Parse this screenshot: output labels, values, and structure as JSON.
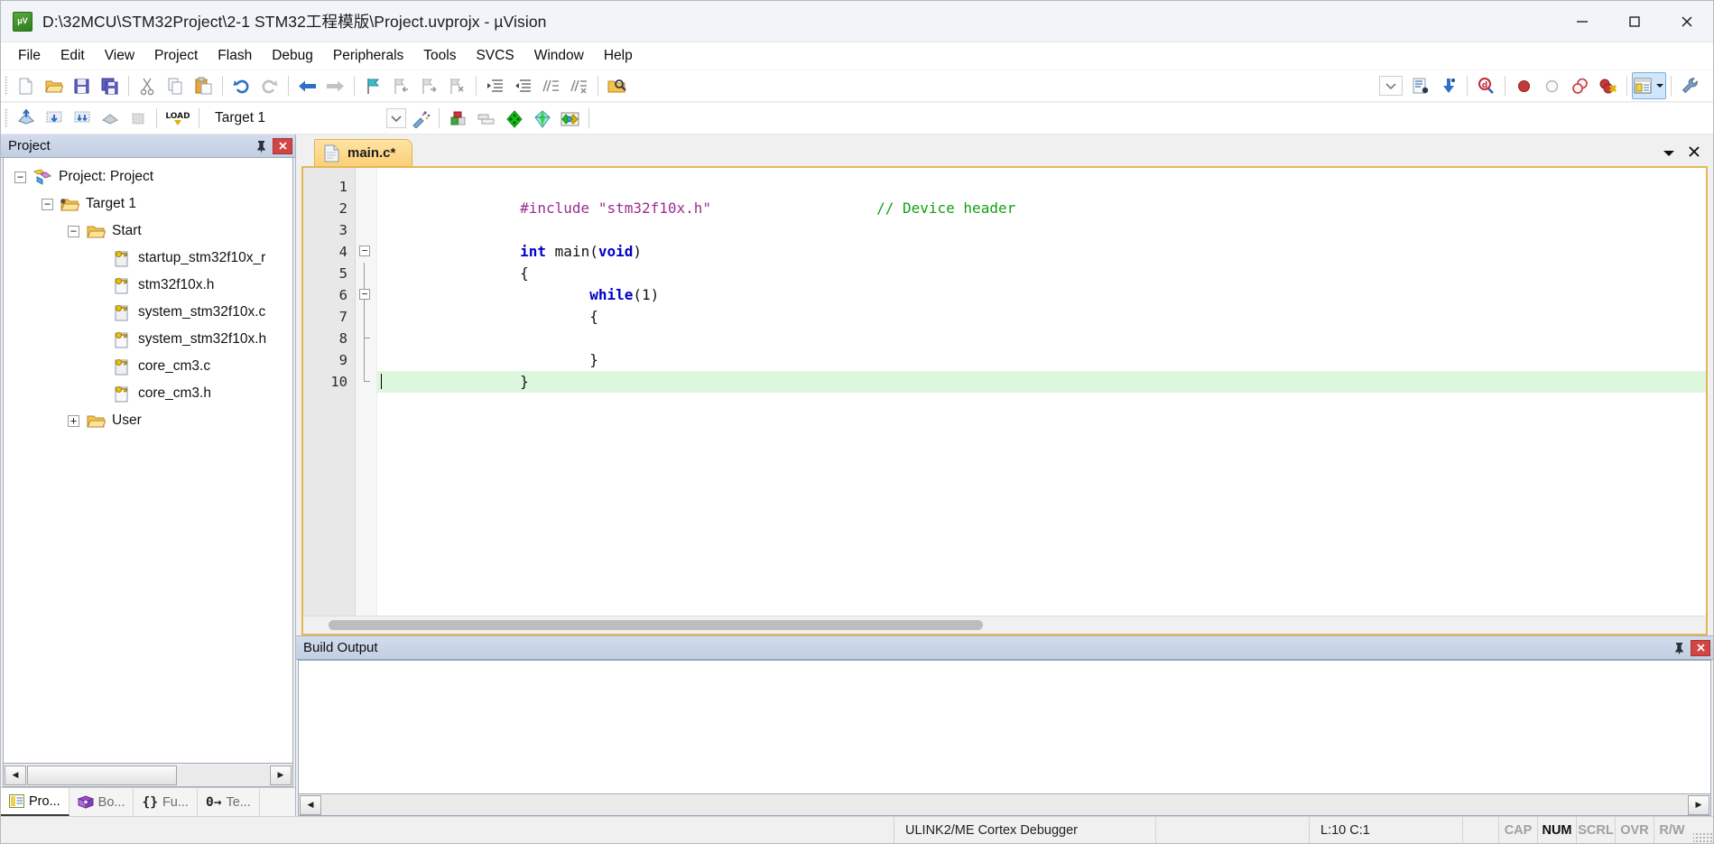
{
  "window": {
    "title": "D:\\32MCU\\STM32Project\\2-1 STM32工程模版\\Project.uvprojx - µVision",
    "app_icon": "uvision-icon",
    "minimize": "—",
    "maximize": "☐",
    "close": "✕"
  },
  "menu": {
    "items": [
      {
        "label": "File"
      },
      {
        "label": "Edit"
      },
      {
        "label": "View"
      },
      {
        "label": "Project"
      },
      {
        "label": "Flash"
      },
      {
        "label": "Debug"
      },
      {
        "label": "Peripherals"
      },
      {
        "label": "Tools"
      },
      {
        "label": "SVCS"
      },
      {
        "label": "Window"
      },
      {
        "label": "Help"
      }
    ]
  },
  "file_toolbar": {
    "buttons": [
      {
        "name": "new-file-icon",
        "title": "New"
      },
      {
        "name": "open-file-icon",
        "title": "Open"
      },
      {
        "name": "save-icon",
        "title": "Save"
      },
      {
        "name": "save-all-icon",
        "title": "Save All"
      },
      {
        "name": "cut-icon",
        "title": "Cut"
      },
      {
        "name": "copy-icon",
        "title": "Copy"
      },
      {
        "name": "paste-icon",
        "title": "Paste"
      },
      {
        "name": "undo-icon",
        "title": "Undo"
      },
      {
        "name": "redo-icon",
        "title": "Redo"
      },
      {
        "name": "navigate-back-icon",
        "title": "Back"
      },
      {
        "name": "navigate-forward-icon",
        "title": "Forward"
      },
      {
        "name": "bookmark-toggle-icon",
        "title": "Insert/Remove Bookmark"
      },
      {
        "name": "bookmark-prev-icon",
        "title": "Previous Bookmark"
      },
      {
        "name": "bookmark-next-icon",
        "title": "Next Bookmark"
      },
      {
        "name": "bookmark-clear-icon",
        "title": "Clear All Bookmarks"
      },
      {
        "name": "indent-icon",
        "title": "Indent"
      },
      {
        "name": "outdent-icon",
        "title": "Outdent"
      },
      {
        "name": "comment-icon",
        "title": "Comment"
      },
      {
        "name": "uncomment-icon",
        "title": "Uncomment"
      },
      {
        "name": "find-in-files-icon",
        "title": "Find in Files"
      }
    ],
    "search_combo_placeholder": "",
    "search_combo_value": "",
    "right_buttons": [
      {
        "name": "bookmark-list-icon",
        "title": "Go to definition"
      },
      {
        "name": "insert-download-icon",
        "title": "Insert"
      },
      {
        "name": "find-icon",
        "title": "Find"
      },
      {
        "name": "breakpoint-insert-icon",
        "title": "Insert/Remove Breakpoint"
      },
      {
        "name": "breakpoint-disable-icon",
        "title": "Enable/Disable Breakpoint"
      },
      {
        "name": "breakpoint-disable-all-icon",
        "title": "Disable All Breakpoints"
      },
      {
        "name": "breakpoint-kill-all-icon",
        "title": "Kill All Breakpoints"
      },
      {
        "name": "window-panels-icon",
        "title": "Show Panels"
      },
      {
        "name": "configure-icon",
        "title": "Configuration Wizard"
      }
    ]
  },
  "build_toolbar": {
    "buttons": [
      {
        "name": "translate-file-icon",
        "title": "Translate"
      },
      {
        "name": "build-target-icon",
        "title": "Build"
      },
      {
        "name": "rebuild-all-icon",
        "title": "Rebuild"
      },
      {
        "name": "batch-build-icon",
        "title": "Batch Build"
      },
      {
        "name": "stop-build-icon",
        "title": "Stop Build"
      },
      {
        "name": "download-load-icon",
        "title": "Download"
      }
    ],
    "target_label": "Target 1",
    "target_dropdown_icon": "chevron-down-icon",
    "right_buttons": [
      {
        "name": "options-target-icon",
        "title": "Options for Target"
      },
      {
        "name": "manage-runtime-icon",
        "title": "Manage Run-Time Environment"
      },
      {
        "name": "manage-multi-project-icon",
        "title": "Multi-Project"
      },
      {
        "name": "manage-components-icon",
        "title": "Manage Components"
      },
      {
        "name": "pack-installer-icon",
        "title": "Pack Installer"
      },
      {
        "name": "manage-project-items-icon",
        "title": "Manage Project Items"
      }
    ]
  },
  "project_panel": {
    "caption": "Project",
    "pin_icon": "pin-icon",
    "close_icon": "close-icon",
    "tree": [
      {
        "label": "Project: Project",
        "depth": 0,
        "expander": "−",
        "icon": "project-icon"
      },
      {
        "label": "Target 1",
        "depth": 1,
        "expander": "−",
        "icon": "target-folder-icon"
      },
      {
        "label": "Start",
        "depth": 2,
        "expander": "−",
        "icon": "group-folder-icon"
      },
      {
        "label": "startup_stm32f10x_r",
        "depth": 3,
        "expander": "",
        "icon": "source-file-icon"
      },
      {
        "label": "stm32f10x.h",
        "depth": 3,
        "expander": "",
        "icon": "source-file-icon"
      },
      {
        "label": "system_stm32f10x.c",
        "depth": 3,
        "expander": "",
        "icon": "source-file-icon"
      },
      {
        "label": "system_stm32f10x.h",
        "depth": 3,
        "expander": "",
        "icon": "source-file-icon"
      },
      {
        "label": "core_cm3.c",
        "depth": 3,
        "expander": "",
        "icon": "source-file-icon"
      },
      {
        "label": "core_cm3.h",
        "depth": 3,
        "expander": "",
        "icon": "source-file-icon"
      },
      {
        "label": "User",
        "depth": 2,
        "expander": "+",
        "icon": "group-folder-icon"
      }
    ],
    "scroll_left_icon": "◀",
    "scroll_right_icon": "▶",
    "tabs": [
      {
        "label": "Pro...",
        "icon": "project-tab-icon",
        "active": true
      },
      {
        "label": "Bo...",
        "icon": "books-tab-icon",
        "active": false
      },
      {
        "label": "Fu...",
        "icon": "{}",
        "active": false
      },
      {
        "label": "Te...",
        "icon": "0→",
        "active": false
      }
    ]
  },
  "editor": {
    "tab": {
      "label": "main.c*",
      "icon": "c-file-icon"
    },
    "dropdown_icon": "chevron-down-icon",
    "close_icon": "close-icon",
    "line_numbers": [
      1,
      2,
      3,
      4,
      5,
      6,
      7,
      8,
      9,
      10
    ],
    "current_line": 10,
    "lines": [
      {
        "n": 1,
        "tokens": [
          {
            "t": "#include ",
            "c": "pre"
          },
          {
            "t": "\"stm32f10x.h\"",
            "c": "str"
          },
          {
            "t": "                   ",
            "c": "txt"
          },
          {
            "t": "// Device header",
            "c": "cmt"
          }
        ]
      },
      {
        "n": 2,
        "tokens": []
      },
      {
        "n": 3,
        "tokens": [
          {
            "t": "int",
            "c": "kw"
          },
          {
            "t": " main(",
            "c": "txt"
          },
          {
            "t": "void",
            "c": "kw"
          },
          {
            "t": ")",
            "c": "txt"
          }
        ]
      },
      {
        "n": 4,
        "tokens": [
          {
            "t": "{",
            "c": "txt"
          }
        ],
        "fold": "open"
      },
      {
        "n": 5,
        "tokens": [
          {
            "t": "\t",
            "c": "txt"
          },
          {
            "t": "while",
            "c": "kw"
          },
          {
            "t": "(1)",
            "c": "txt"
          }
        ]
      },
      {
        "n": 6,
        "tokens": [
          {
            "t": "\t{",
            "c": "txt"
          }
        ],
        "fold": "open"
      },
      {
        "n": 7,
        "tokens": []
      },
      {
        "n": 8,
        "tokens": [
          {
            "t": "\t}",
            "c": "txt"
          }
        ],
        "fold": "end"
      },
      {
        "n": 9,
        "tokens": [
          {
            "t": "}",
            "c": "txt"
          }
        ]
      },
      {
        "n": 10,
        "tokens": [],
        "fold": "end"
      }
    ]
  },
  "build_output": {
    "caption": "Build Output",
    "pin_icon": "pin-icon",
    "close_icon": "close-icon",
    "content": "",
    "scroll_left_icon": "◀",
    "scroll_right_icon": "▶"
  },
  "status_bar": {
    "debugger": "ULINK2/ME Cortex Debugger",
    "position": "L:10 C:1",
    "indicators": [
      {
        "label": "CAP",
        "active": false
      },
      {
        "label": "NUM",
        "active": true
      },
      {
        "label": "SCRL",
        "active": false
      },
      {
        "label": "OVR",
        "active": false
      },
      {
        "label": "R/W",
        "active": false
      }
    ]
  },
  "colors": {
    "title_bg": "#f1f4f8",
    "panel_caption": "#c9d5e7",
    "tab_active": "#fbd076",
    "editor_border": "#e4b755",
    "current_line": "#ddf7dd",
    "keyword": "#0000c8",
    "string": "#9b2d8f",
    "comment": "#12a012",
    "close_red": "#d14545"
  }
}
